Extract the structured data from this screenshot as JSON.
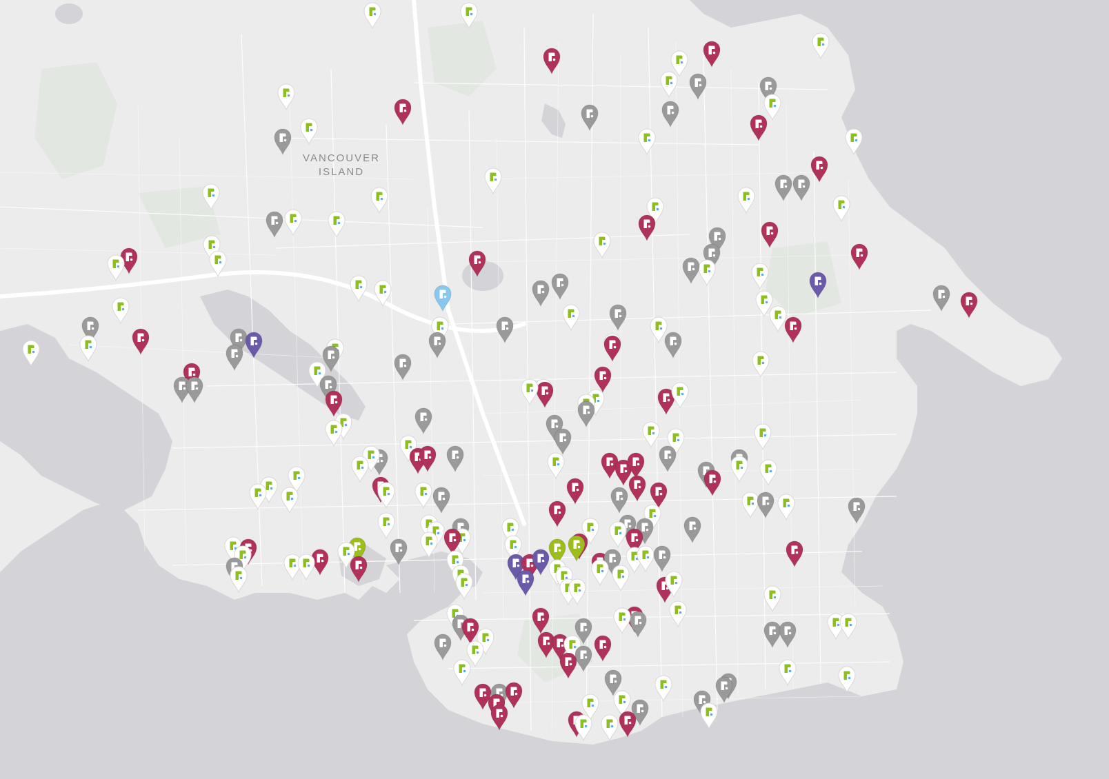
{
  "map": {
    "labels": [
      {
        "name": "island-label",
        "line1": "VANCOUVER",
        "line2": "ISLAND"
      }
    ],
    "colors": {
      "water": "#d4d4d8",
      "land": "#ececec",
      "park": "#e2e7e2",
      "roads": "#ffffff",
      "pin_crimson": "#b0325a",
      "pin_gray": "#9a9a9a",
      "pin_green": "#9cbd1c",
      "pin_purple": "#6a5aa8",
      "pin_blue": "#88c8ee",
      "pin_white": "#ffffff",
      "logo_green": "#8cbf1f"
    },
    "marker_icon": "rental-listing-pin-icon",
    "marker_categories": [
      "crimson",
      "gray",
      "white",
      "green",
      "purple",
      "blue"
    ]
  }
}
